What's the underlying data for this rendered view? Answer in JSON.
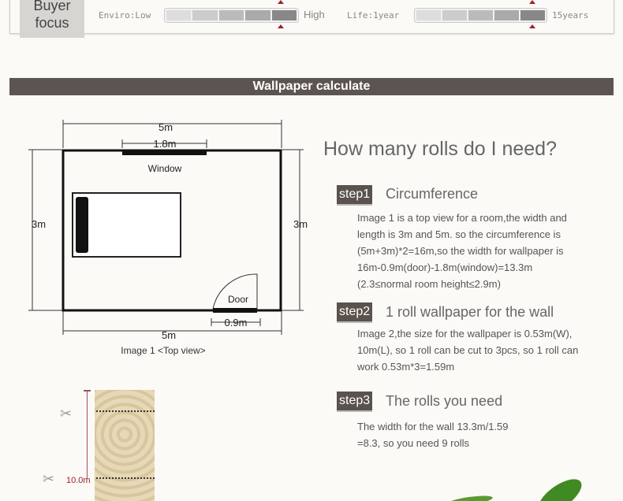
{
  "buyer_focus": {
    "label_line1": "Buyer",
    "label_line2": "focus",
    "enviro": {
      "label": "Enviro:Low",
      "high_label": "High",
      "level": 5,
      "max": 5
    },
    "life": {
      "label": "Life:1year",
      "high_label": "15years",
      "level": 5,
      "max": 5
    }
  },
  "banner": {
    "title": "Wallpaper calculate"
  },
  "diagram": {
    "top_width": "5m",
    "window_width": "1.8m",
    "window_label": "Window",
    "left_height": "3m",
    "right_height": "3m",
    "door_label": "Door",
    "door_width": "0.9m",
    "bottom_width": "5m",
    "caption": "Image 1 <Top view>"
  },
  "roll": {
    "length_label": "10.0m"
  },
  "main": {
    "question": "How many rolls do I need?",
    "steps": [
      {
        "badge": "step1",
        "title": "Circumference",
        "lines": [
          "Image 1 is a top view for a room,the width and",
          "length is 3m and 5m. so the circumference is",
          "(5m+3m)*2=16m,so the width for wallpaper is",
          "16m-0.9m(door)-1.8m(window)=13.3m",
          "(2.3≤normal room height≤2.9m)"
        ]
      },
      {
        "badge": "step2",
        "title": "1 roll wallpaper for the wall",
        "lines": [
          "Image 2,the size for the wallpaper is 0.53m(W),",
          "10m(L), so 1 roll can be cut to 3pcs, so 1 roll can",
          "work 0.53m*3=1.59m"
        ]
      },
      {
        "badge": "step3",
        "title": "The rolls you need",
        "lines": [
          "The width for the wall 13.3m/1.59",
          "=8.3, so you need 9 rolls"
        ]
      }
    ]
  },
  "colors": {
    "banner": "#5c5450",
    "step_badge": "#5a524d",
    "accent_red": "#a0202a"
  }
}
